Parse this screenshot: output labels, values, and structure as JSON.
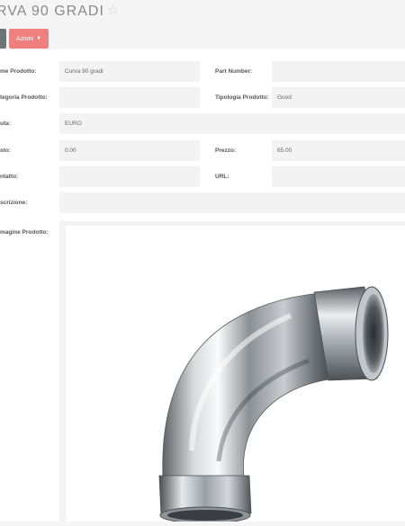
{
  "header": {
    "title": "RVA 90 GRADI",
    "star_icon": "star-outline-icon",
    "actions_label": "Azioni",
    "actions_caret": "▼",
    "actions_color": "#f08080"
  },
  "fields": {
    "nome_label": "me Prodotto:",
    "nome_value": "Curva 90 gradi",
    "part_number_label": "Part Number:",
    "part_number_value": "",
    "categoria_label": "tegoria Prodotto:",
    "categoria_value": "",
    "tipologia_label": "Tipologia Prodotto:",
    "tipologia_value": "Good",
    "valuta_label": "uta:",
    "valuta_value": "EURO",
    "costo_label": "sto:",
    "costo_value": "0.00",
    "prezzo_label": "Prezzo:",
    "prezzo_value": "65.00",
    "contatto_label": "ntatto:",
    "contatto_value": "",
    "url_label": "URL:",
    "url_value": "",
    "descrizione_label": "scrizione:",
    "descrizione_value": "",
    "immagine_label": "magine Prodotto:"
  }
}
